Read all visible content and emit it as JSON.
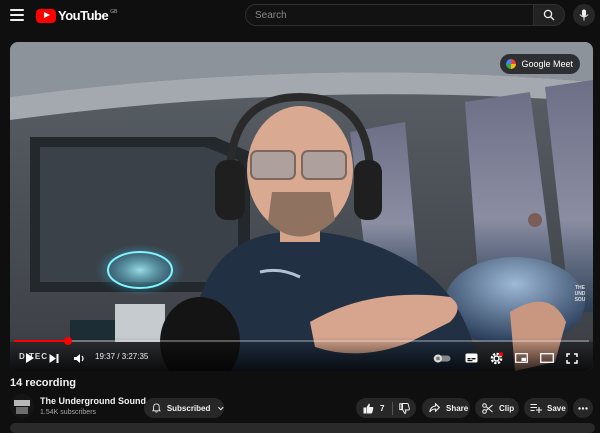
{
  "header": {
    "logo_text": "YouTube",
    "logo_country": "GB",
    "search_placeholder": "Search",
    "icons": [
      "menu-icon",
      "search-icon",
      "mic-icon"
    ]
  },
  "player": {
    "meet_label": "Google Meet",
    "watermark": [
      "THE",
      "UND",
      "SOU"
    ],
    "overlay_text": "D    TEC",
    "current_time": "19:37",
    "duration": "3:27:35",
    "time_display": "19:37 / 3:27:35",
    "progress_fraction": 0.094,
    "icons": [
      "play-icon",
      "next-icon",
      "volume-icon",
      "autoplay-toggle-icon",
      "subtitles-icon",
      "settings-icon",
      "miniplayer-icon",
      "theater-icon",
      "fullscreen-icon"
    ]
  },
  "video": {
    "title": "14 recording",
    "channel_name": "The Underground Sound",
    "subscribers": "1.54K subscribers",
    "subscribe_label": "Subscribed",
    "like_count": "7",
    "share_label": "Share",
    "clip_label": "Clip",
    "save_label": "Save"
  },
  "colors": {
    "brand_red": "#ff0000",
    "background": "#0f0f0f",
    "pill": "#272727"
  }
}
